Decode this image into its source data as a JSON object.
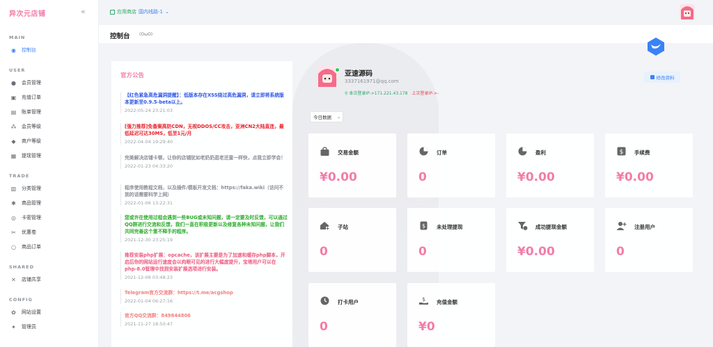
{
  "app": {
    "brand": "异次元店铺",
    "collapse_icon": "double-chevron-left-icon"
  },
  "sidebar": {
    "sections": [
      {
        "title": "MAIN",
        "items": [
          {
            "label": "控制台",
            "icon": "dashboard-icon",
            "active": true
          }
        ]
      },
      {
        "title": "USER",
        "items": [
          {
            "label": "会员管理",
            "icon": "user-icon"
          },
          {
            "label": "充值订单",
            "icon": "wallet-icon"
          },
          {
            "label": "账单管理",
            "icon": "bill-icon"
          },
          {
            "label": "会员等级",
            "icon": "share-icon"
          },
          {
            "label": "商户等级",
            "icon": "diamond-icon"
          },
          {
            "label": "提现管理",
            "icon": "withdraw-icon"
          }
        ]
      },
      {
        "title": "TRADE",
        "items": [
          {
            "label": "分类管理",
            "icon": "category-icon"
          },
          {
            "label": "商品管理",
            "icon": "goods-icon"
          },
          {
            "label": "卡密管理",
            "icon": "card-icon"
          },
          {
            "label": "优惠卷",
            "icon": "coupon-icon"
          },
          {
            "label": "商品订单",
            "icon": "order-icon"
          }
        ]
      },
      {
        "title": "SHARED",
        "items": [
          {
            "label": "店铺共享",
            "icon": "shared-icon"
          }
        ]
      },
      {
        "title": "CONFIG",
        "items": [
          {
            "label": "网站设置",
            "icon": "settings-icon"
          },
          {
            "label": "管理员",
            "icon": "admin-icon"
          }
        ]
      }
    ]
  },
  "header": {
    "store": "应用商店",
    "line": "国内线路-1",
    "page_title": "控制台",
    "page_sub": "(OωO)"
  },
  "notice": {
    "title": "官方公告",
    "items": [
      {
        "text": "【红色紧急高危漏洞提醒】：低版本存在XSS绕过高危漏洞，请立即将系统版本更新至0.9.5-beta以上。",
        "date": "2022-05-24 23:21:03",
        "color": "blue"
      },
      {
        "text": "[强力推荐]免备案高防CDN，无视DDOS/CC攻击，亚洲CN2大陆直连，最低延迟可达30MS，低至1元/月",
        "date": "2022-04-04 19:29:40",
        "color": "red"
      },
      {
        "text": "完美解决店铺卡顿，让你的店铺犹如老奶奶逛老还童一样快，点我立即学会！",
        "date": "2022-01-23 04:33:20",
        "color": "gray"
      },
      {
        "text": "程序使用教程文档，以及插件/模板开发文档：https://faka.wiki（访问不到的话需要科学上网）",
        "date": "2022-01-06 13:22:31",
        "color": "gray"
      },
      {
        "text": "您或许在使用过程会遇到一些BUG或未知问题，请一定要及时反馈，可以通过QQ群进行交流和反馈，我们一直在积极更新以及修复各种未知问题，让我们共同完善这个重不释手的程序。",
        "date": "2021-12-30 23:25:19",
        "color": "green"
      },
      {
        "text": "推荐安装php扩展：opcache，该扩展主要是为了加速和缓存php脚本，开启后你的网站运行速度会以肉眼可见的进行大幅度提升，宝塔用户可以在php-8.0管理中找到安装扩展选项进行安装。",
        "date": "2021-12-06 03:48:23",
        "color": "pink"
      },
      {
        "text": "Telegram官方交流群：https://t.me/acgshop",
        "date": "2022-01-04 06:27:16",
        "color": "rose"
      },
      {
        "text": "官方QQ交流群：849844806",
        "date": "2021-11-27 18:50:47",
        "color": "rose"
      }
    ]
  },
  "profile": {
    "name": "亚速源码",
    "email": "3337161971@qq.com",
    "login_ip": "本次登录IP->171.221.43.178",
    "last_ip": "上次登录IP->-",
    "edit_label": "修改资料",
    "range_label": "今日数据"
  },
  "stats": [
    {
      "label": "交易金额",
      "value": "¥0.00",
      "icon": "bag-icon"
    },
    {
      "label": "订单",
      "value": "0",
      "icon": "pie-chart-icon"
    },
    {
      "label": "盈利",
      "value": "¥0.00",
      "icon": "pie-chart-icon"
    },
    {
      "label": "手续费",
      "value": "¥0.00",
      "icon": "dollar-icon"
    },
    {
      "label": "子站",
      "value": "0",
      "icon": "house-plus-icon"
    },
    {
      "label": "未处理提现",
      "value": "0",
      "icon": "money-icon"
    },
    {
      "label": "成功提现金额",
      "value": "¥0.00",
      "icon": "filter-dollar-icon"
    },
    {
      "label": "注册用户",
      "value": "0",
      "icon": "user-plus-icon"
    },
    {
      "label": "打卡用户",
      "value": "0",
      "icon": "clock-icon"
    },
    {
      "label": "充值金额",
      "value": "¥0",
      "icon": "hand-money-icon"
    }
  ],
  "colors": {
    "accent": "#f27da8",
    "primary": "#3a82f7",
    "green": "#2aa76a"
  }
}
